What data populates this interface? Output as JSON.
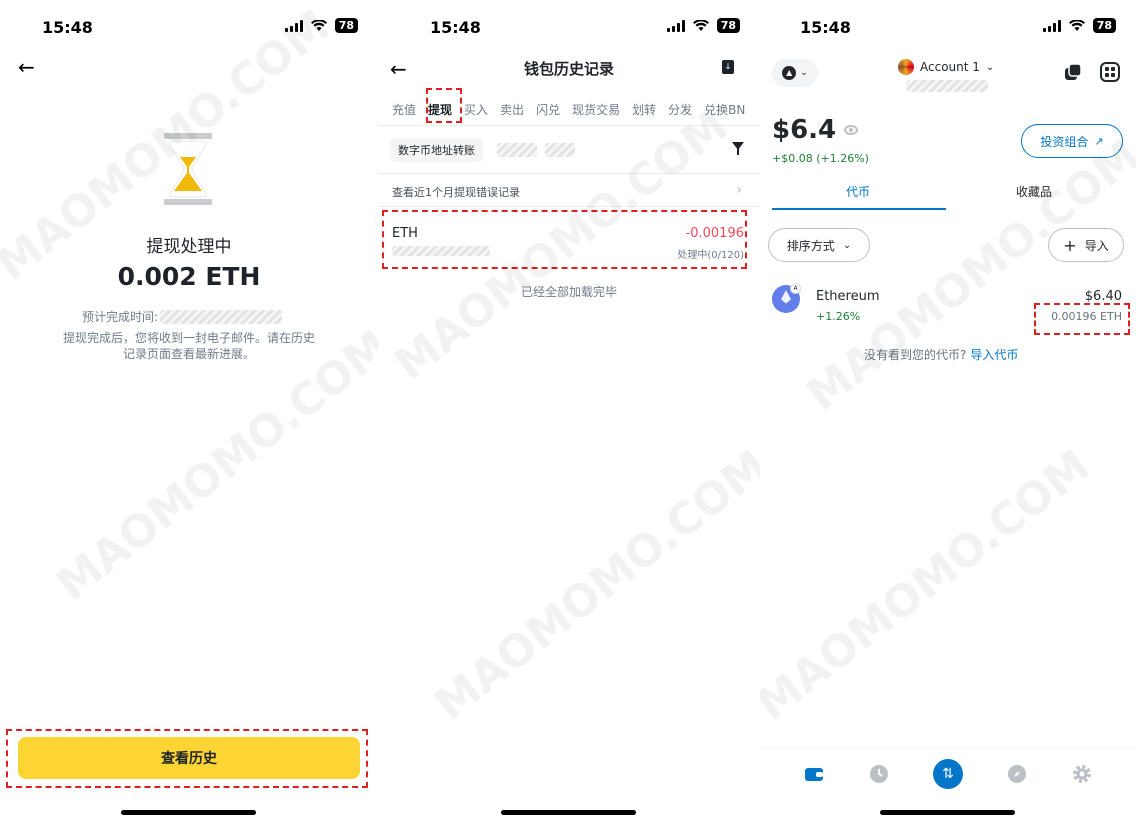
{
  "status": {
    "time1": "15:48",
    "time2": "15:48",
    "time3": "15:48",
    "battery": "78"
  },
  "withdraw_detail": {
    "title": "提现处理中",
    "amount": "0.002 ETH",
    "eta_label": "预计完成时间:",
    "note": "提现完成后，您将收到一封电子邮件。请在历史记录页面查看最新进展。",
    "history_button": "查看历史"
  },
  "wallet_history": {
    "title": "钱包历史记录",
    "tabs": [
      "充值",
      "提现",
      "买入",
      "卖出",
      "闪兑",
      "现货交易",
      "划转",
      "分发",
      "兑换BN"
    ],
    "filter_chip": "数字币地址转账",
    "error_link": "查看近1个月提现错误记录",
    "record": {
      "asset": "ETH",
      "amount": "-0.00196",
      "status": "处理中(0/120)"
    },
    "loaded_text": "已经全部加载完毕"
  },
  "metamask": {
    "account_name": "Account 1",
    "balance": "$6.4",
    "change": "+$0.08 (+1.26%)",
    "portfolio_button": "投资组合",
    "tabs": [
      "代币",
      "收藏品"
    ],
    "sort_button": "排序方式",
    "import_button": "导入",
    "token": {
      "name": "Ethereum",
      "change": "+1.26%",
      "fiat": "$6.40",
      "qty": "0.00196 ETH",
      "badge": "A"
    },
    "import_question": "没有看到您的代币?",
    "import_link": "导入代币"
  },
  "watermark": "MAOMOMO.COM",
  "colors": {
    "binance_yellow": "#fcd535",
    "negative_red": "#f6465d",
    "metamask_blue": "#0376c9",
    "positive_green": "#1c8234",
    "highlight_dash": "#e02020"
  }
}
